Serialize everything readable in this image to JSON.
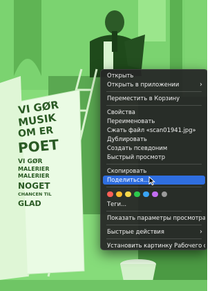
{
  "context_menu": {
    "items": {
      "open": "Открыть",
      "open_with": "Открыть в приложении",
      "move_to_trash": "Переместить в Корзину",
      "get_info": "Свойства",
      "rename": "Переименовать",
      "compress": "Сжать файл «scan01941.jpg»",
      "duplicate": "Дублировать",
      "make_alias": "Создать псевдоним",
      "quick_look": "Быстрый просмотр",
      "copy": "Скопировать",
      "share": "Поделиться...",
      "tags": "Теги...",
      "show_view_options": "Показать параметры просмотра",
      "quick_actions": "Быстрые действия",
      "set_desktop_picture": "Установить картинку Рабочего стола"
    },
    "submenu_indicator": "›",
    "highlighted_item": "share",
    "tag_colors": [
      {
        "name": "red",
        "color": "#fe5f57"
      },
      {
        "name": "orange",
        "color": "#febc2e"
      },
      {
        "name": "yellow",
        "color": "#f7d94c"
      },
      {
        "name": "green",
        "color": "#2cc84d"
      },
      {
        "name": "blue",
        "color": "#39a3f5"
      },
      {
        "name": "purple",
        "color": "#c36df2"
      },
      {
        "name": "gray",
        "color": "#9a9a9a"
      }
    ]
  },
  "photo": {
    "sign_text_lines": [
      "VI GØR",
      "MUSIK",
      "OM ER",
      "POET",
      "VI GØR",
      "MALERIER",
      "MALERIER",
      "NOGET",
      "CHANCEN TIL",
      "GLAD"
    ]
  },
  "colors": {
    "tint": "#7bd970",
    "highlight": "#2f6ee0",
    "menu_bg": "#262626"
  }
}
